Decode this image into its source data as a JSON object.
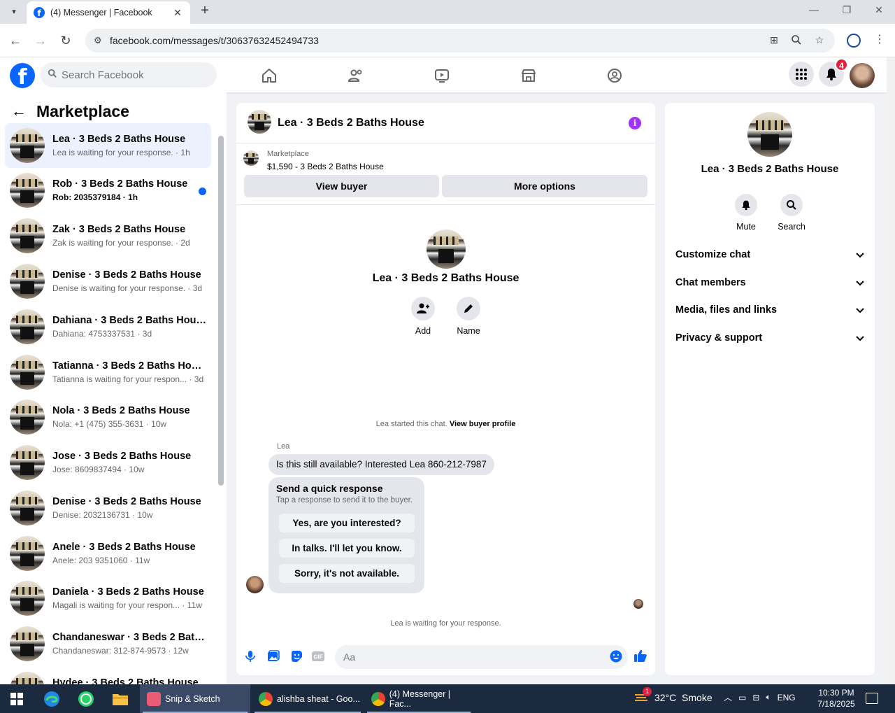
{
  "browser": {
    "tab_title": "(4) Messenger | Facebook",
    "url": "facebook.com/messages/t/30637632452494733"
  },
  "fb_header": {
    "search_placeholder": "Search Facebook",
    "notification_count": "4",
    "brand_color": "#0866ff"
  },
  "left_panel": {
    "title": "Marketplace",
    "conversations": [
      {
        "name": "Lea · 3 Beds 2 Baths House",
        "sub": "Lea is waiting for your response. · 1h",
        "active": true,
        "unread": false
      },
      {
        "name": "Rob · 3 Beds 2 Baths House",
        "sub": "Rob: 2035379184 · 1h",
        "active": false,
        "unread": true
      },
      {
        "name": "Zak · 3 Beds 2 Baths House",
        "sub": "Zak is waiting for your response. · 2d"
      },
      {
        "name": "Denise · 3 Beds 2 Baths House",
        "sub": "Denise is waiting for your response. · 3d"
      },
      {
        "name": "Dahiana · 3 Beds 2 Baths House",
        "sub": "Dahiana: 4753337531 · 3d"
      },
      {
        "name": "Tatianna · 3 Beds 2 Baths House",
        "sub": "Tatianna is waiting for your respon... · 3d"
      },
      {
        "name": "Nola · 3 Beds 2 Baths House",
        "sub": "Nola: +1 (475) 355-3631 · 10w"
      },
      {
        "name": "Jose · 3 Beds 2 Baths House",
        "sub": "Jose: 8609837494 · 10w"
      },
      {
        "name": "Denise · 3 Beds 2 Baths House",
        "sub": "Denise: 2032136731 · 10w"
      },
      {
        "name": "Anele · 3 Beds 2 Baths House",
        "sub": "Anele: 203 9351060 · 11w"
      },
      {
        "name": "Daniela · 3 Beds 2 Baths House",
        "sub": "Magali is waiting for your respon... · 11w"
      },
      {
        "name": "Chandaneswar · 3 Beds 2 Baths ...",
        "sub": "Chandaneswar: 312-874-9573 · 12w"
      },
      {
        "name": "Hydee · 3 Beds 2 Baths House",
        "sub": ""
      }
    ]
  },
  "chat": {
    "title": "Lea · 3 Beds 2 Baths House",
    "listing_category": "Marketplace",
    "listing_price": "$1,590 - 3 Beds 2 Baths House",
    "view_buyer_label": "View buyer",
    "more_options_label": "More options",
    "profile_name": "Lea · 3 Beds 2 Baths House",
    "add_label": "Add",
    "name_label": "Name",
    "started_text": "Lea started this chat.",
    "view_buyer_profile": "View buyer profile",
    "sender": "Lea",
    "message": "Is this still available? Interested Lea 860-212-7987",
    "quick_title": "Send a quick response",
    "quick_sub": "Tap a response to send it to the buyer.",
    "quick_options": [
      "Yes, are you interested?",
      "In talks. I'll let you know.",
      "Sorry, it's not available."
    ],
    "waiting_text": "Lea is waiting for your response.",
    "input_placeholder": "Aa"
  },
  "right_panel": {
    "name": "Lea · 3 Beds 2 Baths House",
    "mute_label": "Mute",
    "search_label": "Search",
    "sections": [
      "Customize chat",
      "Chat members",
      "Media, files and links",
      "Privacy & support"
    ]
  },
  "taskbar": {
    "apps": [
      "Snip & Sketch",
      "alishba sheat - Goo...",
      "(4) Messenger | Fac..."
    ],
    "weather_badge": "1",
    "weather": "32°C  Smoke",
    "lang": "ENG",
    "time": "10:30 PM",
    "date": "7/18/2025"
  }
}
